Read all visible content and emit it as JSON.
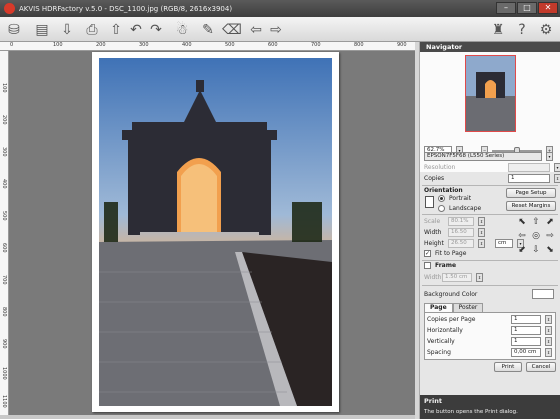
{
  "window": {
    "title": "AKVIS HDRFactory v.5.0 - DSC_1100.jpg (RGB/8, 2616x3904)",
    "minimize": "–",
    "maximize": "□",
    "close": "✕"
  },
  "toolbar": {
    "buttons": [
      {
        "name": "open-icon",
        "glyph": "⛁"
      },
      {
        "name": "save-icon",
        "glyph": "▤"
      },
      {
        "name": "export-icon",
        "glyph": "⇩"
      },
      {
        "name": "print-icon",
        "glyph": "⎙"
      },
      {
        "name": "upload-icon",
        "glyph": "⇧"
      },
      {
        "name": "undo-icon",
        "glyph": "↶"
      },
      {
        "name": "redo-icon",
        "glyph": "↷"
      },
      {
        "name": "ghost-icon",
        "glyph": "☃"
      },
      {
        "name": "brush-icon",
        "glyph": "✎"
      },
      {
        "name": "eraser-icon",
        "glyph": "⌫"
      },
      {
        "name": "back-arrow-icon",
        "glyph": "⇦"
      },
      {
        "name": "forward-arrow-icon",
        "glyph": "⇨"
      },
      {
        "name": "about-icon",
        "glyph": "♜"
      },
      {
        "name": "help-icon",
        "glyph": "?"
      },
      {
        "name": "settings-icon",
        "glyph": "⚙"
      }
    ]
  },
  "ruler": {
    "h_ticks": [
      "0",
      "100",
      "200",
      "300",
      "400",
      "500",
      "600",
      "700",
      "800",
      "900"
    ],
    "v_ticks": [
      "100",
      "200",
      "300",
      "400",
      "500",
      "600",
      "700",
      "800",
      "900",
      "1000",
      "1100"
    ]
  },
  "navigator": {
    "title": "Navigator",
    "zoom": "62.7%",
    "zoom_out": "−",
    "zoom_in": "+"
  },
  "print": {
    "printer": "EPSON7F5F68 (L550 Series)",
    "resolution_label": "Resolution",
    "copies_label": "Copies",
    "copies": "1",
    "orientation_title": "Orientation",
    "portrait": "Portrait",
    "landscape": "Landscape",
    "page_setup": "Page Setup",
    "reset_margins": "Reset Margins",
    "scale_label": "Scale",
    "scale": "80.1%",
    "width_label": "Width",
    "width": "16.50",
    "height_label": "Height",
    "height": "26.50",
    "unit": "cm",
    "fit_to_page": "Fit to Page",
    "frame_title": "Frame",
    "frame_width_label": "Width",
    "frame_width": "1.50 cm",
    "background_color_label": "Background Color",
    "background_color": "#ffffff",
    "tab_page": "Page",
    "tab_poster": "Poster",
    "copies_per_page_label": "Copies per Page",
    "copies_per_page": "1",
    "horizontally_label": "Horizontally",
    "horizontally": "1",
    "vertically_label": "Vertically",
    "vertically": "1",
    "spacing_label": "Spacing",
    "spacing": "0,00 cm",
    "print_button": "Print",
    "cancel_button": "Cancel"
  },
  "help": {
    "title": "Print",
    "text": "The button opens the Print dialog."
  },
  "colors": {
    "canvas_bg": "#7a7a7a",
    "accent_red": "#e04a4a",
    "panel_bg": "#e6e6e6"
  }
}
